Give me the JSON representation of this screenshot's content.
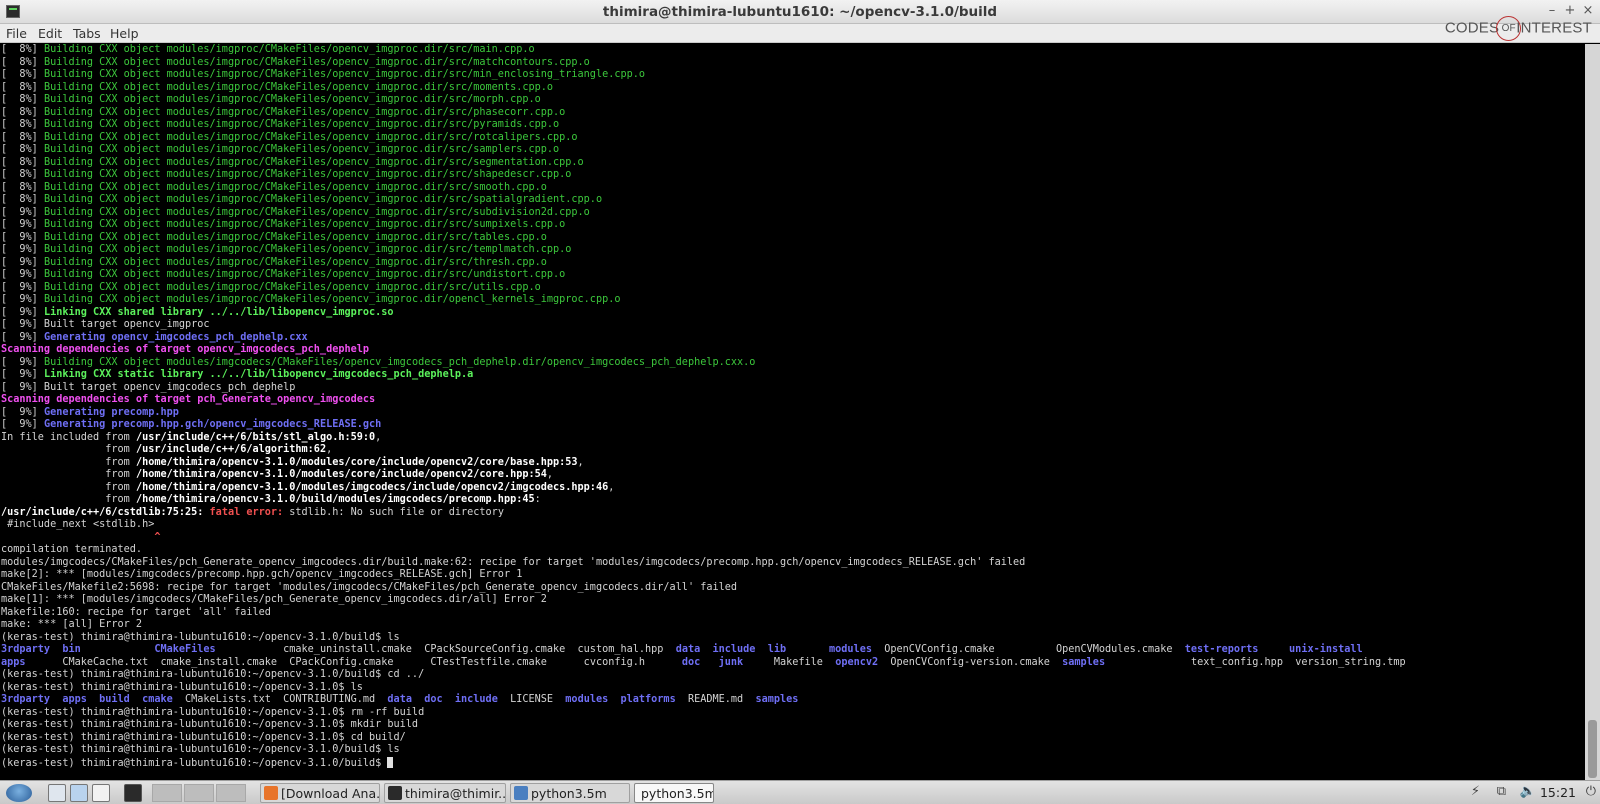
{
  "window": {
    "title": "thimira@thimira-lubuntu1610: ~/opencv-3.1.0/build",
    "controls": {
      "minimize": "–",
      "maximize": "+",
      "close": "×"
    }
  },
  "menu": [
    "File",
    "Edit",
    "Tabs",
    "Help"
  ],
  "watermark": {
    "before": "CODES",
    "ring": "OF",
    "after": "INTEREST"
  },
  "terminal": {
    "lines": [
      [
        {
          "c": "n",
          "t": "[  8%] "
        },
        {
          "c": "g",
          "t": "Building CXX object modules/imgproc/CMakeFiles/opencv_imgproc.dir/src/main.cpp.o"
        }
      ],
      [
        {
          "c": "n",
          "t": "[  8%] "
        },
        {
          "c": "g",
          "t": "Building CXX object modules/imgproc/CMakeFiles/opencv_imgproc.dir/src/matchcontours.cpp.o"
        }
      ],
      [
        {
          "c": "n",
          "t": "[  8%] "
        },
        {
          "c": "g",
          "t": "Building CXX object modules/imgproc/CMakeFiles/opencv_imgproc.dir/src/min_enclosing_triangle.cpp.o"
        }
      ],
      [
        {
          "c": "n",
          "t": "[  8%] "
        },
        {
          "c": "g",
          "t": "Building CXX object modules/imgproc/CMakeFiles/opencv_imgproc.dir/src/moments.cpp.o"
        }
      ],
      [
        {
          "c": "n",
          "t": "[  8%] "
        },
        {
          "c": "g",
          "t": "Building CXX object modules/imgproc/CMakeFiles/opencv_imgproc.dir/src/morph.cpp.o"
        }
      ],
      [
        {
          "c": "n",
          "t": "[  8%] "
        },
        {
          "c": "g",
          "t": "Building CXX object modules/imgproc/CMakeFiles/opencv_imgproc.dir/src/phasecorr.cpp.o"
        }
      ],
      [
        {
          "c": "n",
          "t": "[  8%] "
        },
        {
          "c": "g",
          "t": "Building CXX object modules/imgproc/CMakeFiles/opencv_imgproc.dir/src/pyramids.cpp.o"
        }
      ],
      [
        {
          "c": "n",
          "t": "[  8%] "
        },
        {
          "c": "g",
          "t": "Building CXX object modules/imgproc/CMakeFiles/opencv_imgproc.dir/src/rotcalipers.cpp.o"
        }
      ],
      [
        {
          "c": "n",
          "t": "[  8%] "
        },
        {
          "c": "g",
          "t": "Building CXX object modules/imgproc/CMakeFiles/opencv_imgproc.dir/src/samplers.cpp.o"
        }
      ],
      [
        {
          "c": "n",
          "t": "[  8%] "
        },
        {
          "c": "g",
          "t": "Building CXX object modules/imgproc/CMakeFiles/opencv_imgproc.dir/src/segmentation.cpp.o"
        }
      ],
      [
        {
          "c": "n",
          "t": "[  8%] "
        },
        {
          "c": "g",
          "t": "Building CXX object modules/imgproc/CMakeFiles/opencv_imgproc.dir/src/shapedescr.cpp.o"
        }
      ],
      [
        {
          "c": "n",
          "t": "[  8%] "
        },
        {
          "c": "g",
          "t": "Building CXX object modules/imgproc/CMakeFiles/opencv_imgproc.dir/src/smooth.cpp.o"
        }
      ],
      [
        {
          "c": "n",
          "t": "[  8%] "
        },
        {
          "c": "g",
          "t": "Building CXX object modules/imgproc/CMakeFiles/opencv_imgproc.dir/src/spatialgradient.cpp.o"
        }
      ],
      [
        {
          "c": "n",
          "t": "[  9%] "
        },
        {
          "c": "g",
          "t": "Building CXX object modules/imgproc/CMakeFiles/opencv_imgproc.dir/src/subdivision2d.cpp.o"
        }
      ],
      [
        {
          "c": "n",
          "t": "[  9%] "
        },
        {
          "c": "g",
          "t": "Building CXX object modules/imgproc/CMakeFiles/opencv_imgproc.dir/src/sumpixels.cpp.o"
        }
      ],
      [
        {
          "c": "n",
          "t": "[  9%] "
        },
        {
          "c": "g",
          "t": "Building CXX object modules/imgproc/CMakeFiles/opencv_imgproc.dir/src/tables.cpp.o"
        }
      ],
      [
        {
          "c": "n",
          "t": "[  9%] "
        },
        {
          "c": "g",
          "t": "Building CXX object modules/imgproc/CMakeFiles/opencv_imgproc.dir/src/templmatch.cpp.o"
        }
      ],
      [
        {
          "c": "n",
          "t": "[  9%] "
        },
        {
          "c": "g",
          "t": "Building CXX object modules/imgproc/CMakeFiles/opencv_imgproc.dir/src/thresh.cpp.o"
        }
      ],
      [
        {
          "c": "n",
          "t": "[  9%] "
        },
        {
          "c": "g",
          "t": "Building CXX object modules/imgproc/CMakeFiles/opencv_imgproc.dir/src/undistort.cpp.o"
        }
      ],
      [
        {
          "c": "n",
          "t": "[  9%] "
        },
        {
          "c": "g",
          "t": "Building CXX object modules/imgproc/CMakeFiles/opencv_imgproc.dir/src/utils.cpp.o"
        }
      ],
      [
        {
          "c": "n",
          "t": "[  9%] "
        },
        {
          "c": "g",
          "t": "Building CXX object modules/imgproc/CMakeFiles/opencv_imgproc.dir/opencl_kernels_imgproc.cpp.o"
        }
      ],
      [
        {
          "c": "n",
          "t": "[  9%] "
        },
        {
          "c": "gb",
          "t": "Linking CXX shared library ../../lib/libopencv_imgproc.so"
        }
      ],
      [
        {
          "c": "n",
          "t": "[  9%] Built target opencv_imgproc"
        }
      ],
      [
        {
          "c": "n",
          "t": "[  9%] "
        },
        {
          "c": "b",
          "t": "Generating opencv_imgcodecs_pch_dephelp.cxx"
        }
      ],
      [
        {
          "c": "m",
          "t": "Scanning dependencies of target opencv_imgcodecs_pch_dephelp"
        }
      ],
      [
        {
          "c": "n",
          "t": "[  9%] "
        },
        {
          "c": "g",
          "t": "Building CXX object modules/imgcodecs/CMakeFiles/opencv_imgcodecs_pch_dephelp.dir/opencv_imgcodecs_pch_dephelp.cxx.o"
        }
      ],
      [
        {
          "c": "n",
          "t": "[  9%] "
        },
        {
          "c": "gb",
          "t": "Linking CXX static library ../../lib/libopencv_imgcodecs_pch_dephelp.a"
        }
      ],
      [
        {
          "c": "n",
          "t": "[  9%] Built target opencv_imgcodecs_pch_dephelp"
        }
      ],
      [
        {
          "c": "m",
          "t": "Scanning dependencies of target pch_Generate_opencv_imgcodecs"
        }
      ],
      [
        {
          "c": "n",
          "t": "[  9%] "
        },
        {
          "c": "b",
          "t": "Generating precomp.hpp"
        }
      ],
      [
        {
          "c": "n",
          "t": "[  9%] "
        },
        {
          "c": "b",
          "t": "Generating precomp.hpp.gch/opencv_imgcodecs_RELEASE.gch"
        }
      ],
      [
        {
          "c": "n",
          "t": "In file included from "
        },
        {
          "c": "w",
          "t": "/usr/include/c++/6/bits/stl_algo.h:59:0"
        },
        {
          "c": "n",
          "t": ","
        }
      ],
      [
        {
          "c": "n",
          "t": "                 from "
        },
        {
          "c": "w",
          "t": "/usr/include/c++/6/algorithm:62"
        },
        {
          "c": "n",
          "t": ","
        }
      ],
      [
        {
          "c": "n",
          "t": "                 from "
        },
        {
          "c": "w",
          "t": "/home/thimira/opencv-3.1.0/modules/core/include/opencv2/core/base.hpp:53"
        },
        {
          "c": "n",
          "t": ","
        }
      ],
      [
        {
          "c": "n",
          "t": "                 from "
        },
        {
          "c": "w",
          "t": "/home/thimira/opencv-3.1.0/modules/core/include/opencv2/core.hpp:54"
        },
        {
          "c": "n",
          "t": ","
        }
      ],
      [
        {
          "c": "n",
          "t": "                 from "
        },
        {
          "c": "w",
          "t": "/home/thimira/opencv-3.1.0/modules/imgcodecs/include/opencv2/imgcodecs.hpp:46"
        },
        {
          "c": "n",
          "t": ","
        }
      ],
      [
        {
          "c": "n",
          "t": "                 from "
        },
        {
          "c": "w",
          "t": "/home/thimira/opencv-3.1.0/build/modules/imgcodecs/precomp.hpp:45"
        },
        {
          "c": "n",
          "t": ":"
        }
      ],
      [
        {
          "c": "w",
          "t": "/usr/include/c++/6/cstdlib:75:25: "
        },
        {
          "c": "r",
          "t": "fatal error: "
        },
        {
          "c": "n",
          "t": "stdlib.h: No such file or directory"
        }
      ],
      [
        {
          "c": "n",
          "t": " #include_next <stdlib.h>"
        }
      ],
      [
        {
          "c": "r",
          "t": "                         ^"
        }
      ],
      [
        {
          "c": "n",
          "t": "compilation terminated."
        }
      ],
      [
        {
          "c": "n",
          "t": "modules/imgcodecs/CMakeFiles/pch_Generate_opencv_imgcodecs.dir/build.make:62: recipe for target 'modules/imgcodecs/precomp.hpp.gch/opencv_imgcodecs_RELEASE.gch' failed"
        }
      ],
      [
        {
          "c": "n",
          "t": "make[2]: *** [modules/imgcodecs/precomp.hpp.gch/opencv_imgcodecs_RELEASE.gch] Error 1"
        }
      ],
      [
        {
          "c": "n",
          "t": "CMakeFiles/Makefile2:5698: recipe for target 'modules/imgcodecs/CMakeFiles/pch_Generate_opencv_imgcodecs.dir/all' failed"
        }
      ],
      [
        {
          "c": "n",
          "t": "make[1]: *** [modules/imgcodecs/CMakeFiles/pch_Generate_opencv_imgcodecs.dir/all] Error 2"
        }
      ],
      [
        {
          "c": "n",
          "t": "Makefile:160: recipe for target 'all' failed"
        }
      ],
      [
        {
          "c": "n",
          "t": "make: *** [all] Error 2"
        }
      ],
      [
        {
          "c": "n",
          "t": "(keras-test) thimira@thimira-lubuntu1610:~/opencv-3.1.0/build$ ls"
        }
      ],
      [
        {
          "c": "b",
          "t": "3rdparty  bin            CMakeFiles"
        },
        {
          "c": "n",
          "t": "           cmake_uninstall.cmake  CPackSourceConfig.cmake  custom_hal.hpp  "
        },
        {
          "c": "b",
          "t": "data  include  lib       modules"
        },
        {
          "c": "n",
          "t": "  OpenCVConfig.cmake          OpenCVModules.cmake  "
        },
        {
          "c": "b",
          "t": "test-reports     unix-install"
        }
      ],
      [
        {
          "c": "b",
          "t": "apps"
        },
        {
          "c": "n",
          "t": "      CMakeCache.txt  cmake_install.cmake  CPackConfig.cmake      CTestTestfile.cmake      cvconfig.h      "
        },
        {
          "c": "b",
          "t": "doc   junk"
        },
        {
          "c": "n",
          "t": "     Makefile  "
        },
        {
          "c": "b",
          "t": "opencv2"
        },
        {
          "c": "n",
          "t": "  OpenCVConfig-version.cmake  "
        },
        {
          "c": "b",
          "t": "samples"
        },
        {
          "c": "n",
          "t": "              text_config.hpp  version_string.tmp"
        }
      ],
      [
        {
          "c": "n",
          "t": "(keras-test) thimira@thimira-lubuntu1610:~/opencv-3.1.0/build$ cd ../"
        }
      ],
      [
        {
          "c": "n",
          "t": "(keras-test) thimira@thimira-lubuntu1610:~/opencv-3.1.0$ ls"
        }
      ],
      [
        {
          "c": "b",
          "t": "3rdparty  apps  build  cmake"
        },
        {
          "c": "n",
          "t": "  CMakeLists.txt  CONTRIBUTING.md  "
        },
        {
          "c": "b",
          "t": "data  doc  include"
        },
        {
          "c": "n",
          "t": "  LICENSE  "
        },
        {
          "c": "b",
          "t": "modules  platforms"
        },
        {
          "c": "n",
          "t": "  README.md  "
        },
        {
          "c": "b",
          "t": "samples"
        }
      ],
      [
        {
          "c": "n",
          "t": "(keras-test) thimira@thimira-lubuntu1610:~/opencv-3.1.0$ rm -rf build"
        }
      ],
      [
        {
          "c": "n",
          "t": "(keras-test) thimira@thimira-lubuntu1610:~/opencv-3.1.0$ mkdir build"
        }
      ],
      [
        {
          "c": "n",
          "t": "(keras-test) thimira@thimira-lubuntu1610:~/opencv-3.1.0$ cd build/"
        }
      ],
      [
        {
          "c": "n",
          "t": "(keras-test) thimira@thimira-lubuntu1610:~/opencv-3.1.0/build$ ls"
        }
      ],
      [
        {
          "c": "n",
          "t": "(keras-test) thimira@thimira-lubuntu1610:~/opencv-3.1.0/build$ "
        },
        {
          "c": "cursor",
          "t": ""
        }
      ]
    ]
  },
  "taskbar": {
    "tasks": [
      {
        "label": "[Download Ana...",
        "icon": "firefox-icon",
        "active": false
      },
      {
        "label": "thimira@thimir...",
        "icon": "terminal-icon",
        "active": false
      },
      {
        "label": "python3.5m",
        "icon": "folder-icon",
        "active": false
      },
      {
        "label": "python3.5m",
        "icon": "",
        "active": true
      }
    ],
    "clock": "15:21"
  },
  "colors": {
    "terminal_bg": "#000000",
    "build_green": "#3cc83c",
    "link_green": "#5cf25c",
    "dir_blue": "#6f6ff5",
    "scan_magenta": "#f050f0",
    "error_red": "#f05050"
  }
}
